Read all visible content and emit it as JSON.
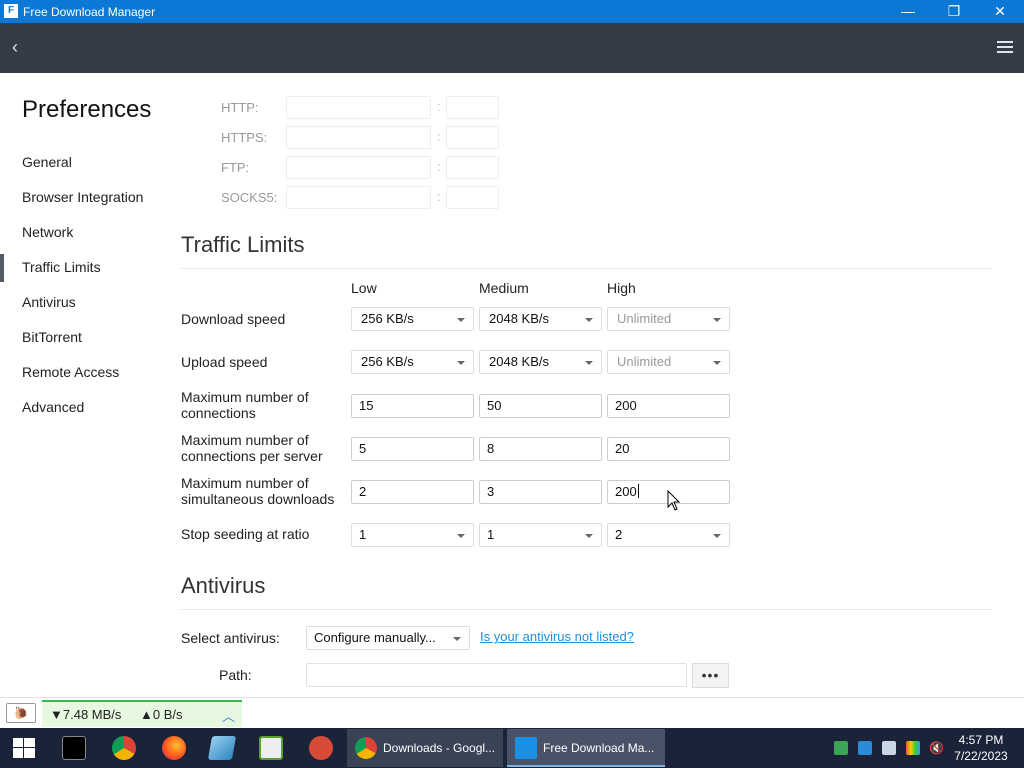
{
  "window": {
    "title": "Free Download Manager",
    "controls": {
      "minimize": "—",
      "restore": "❐",
      "close": "✕"
    }
  },
  "sidebar": {
    "title": "Preferences",
    "items": [
      {
        "label": "General"
      },
      {
        "label": "Browser Integration"
      },
      {
        "label": "Network"
      },
      {
        "label": "Traffic Limits",
        "active": true
      },
      {
        "label": "Antivirus"
      },
      {
        "label": "BitTorrent"
      },
      {
        "label": "Remote Access"
      },
      {
        "label": "Advanced"
      }
    ]
  },
  "proxy": {
    "rows": [
      {
        "label": "HTTP:",
        "host": "",
        "port": ""
      },
      {
        "label": "HTTPS:",
        "host": "",
        "port": ""
      },
      {
        "label": "FTP:",
        "host": "",
        "port": ""
      },
      {
        "label": "SOCKS5:",
        "host": "",
        "port": ""
      }
    ],
    "separator": ":"
  },
  "traffic": {
    "title": "Traffic Limits",
    "columns": [
      "Low",
      "Medium",
      "High"
    ],
    "rows": [
      {
        "label": "Download speed",
        "values": [
          "256 KB/s",
          "2048 KB/s",
          "Unlimited"
        ]
      },
      {
        "label": "Upload speed",
        "values": [
          "256 KB/s",
          "2048 KB/s",
          "Unlimited"
        ]
      },
      {
        "label": "Maximum number of connections",
        "values": [
          "15",
          "50",
          "200"
        ]
      },
      {
        "label": "Maximum number of connections per server",
        "values": [
          "5",
          "8",
          "20"
        ]
      },
      {
        "label": "Maximum number of simultaneous downloads",
        "values": [
          "2",
          "3",
          "200"
        ]
      },
      {
        "label": "Stop seeding at ratio",
        "values": [
          "1",
          "1",
          "2"
        ]
      }
    ]
  },
  "antivirus": {
    "title": "Antivirus",
    "select_label": "Select antivirus:",
    "select_value": "Configure manually...",
    "link": "Is your antivirus not listed?",
    "path_label": "Path:",
    "path_value": "",
    "browse_label": "•••"
  },
  "status": {
    "download_speed": "▼7.48 MB/s",
    "upload_speed": "▲0 B/s",
    "expand": "︿"
  },
  "taskbar": {
    "apps": [
      {
        "label": "Downloads - Googl..."
      },
      {
        "label": "Free Download Ma..."
      }
    ],
    "time": "4:57 PM",
    "date": "7/22/2023"
  },
  "colors": {
    "titlebar": "#0a78d4",
    "appbar": "#363b48",
    "link": "#1f8fd6",
    "speed_bg": "#e6f8df",
    "speed_accent": "#3cb853",
    "taskbar": "#1b2338"
  }
}
